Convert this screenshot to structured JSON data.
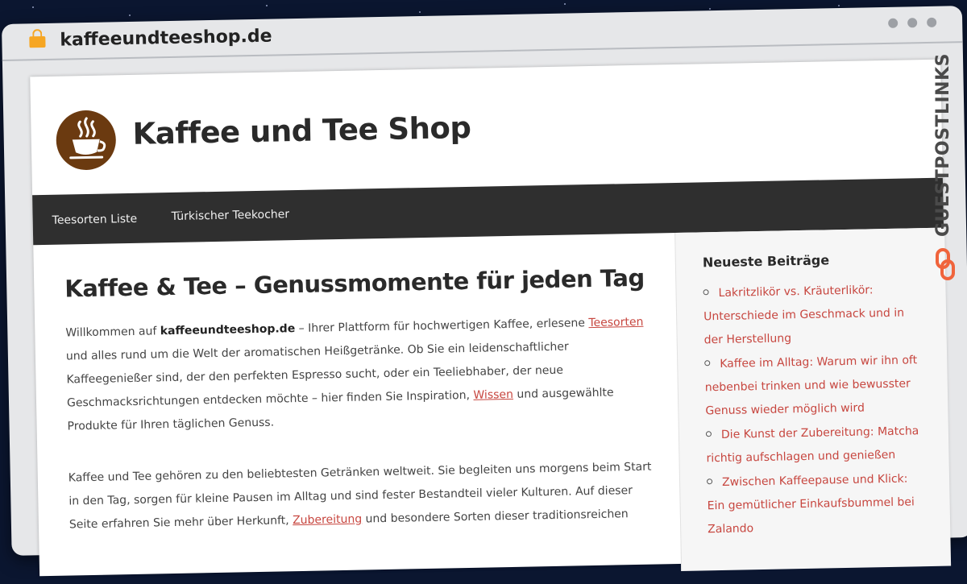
{
  "browser": {
    "url": "kaffeeundteeshop.de"
  },
  "site": {
    "title": "Kaffee und Tee Shop",
    "logo_icon": "coffee-cup-icon",
    "brand_color": "#6b3a10"
  },
  "nav": {
    "items": [
      {
        "label": "Teesorten Liste"
      },
      {
        "label": "Türkischer Teekocher"
      }
    ]
  },
  "main": {
    "headline": "Kaffee & Tee – Genussmomente für jeden Tag",
    "para1": {
      "t1": "Willkommen auf ",
      "bold": "kaffeeundteeshop.de",
      "t2": " – Ihrer Plattform für hochwertigen Kaffee, erlesene ",
      "link1": "Teesorten",
      "t3": " und alles rund um die Welt der aromatischen Heißgetränke. Ob Sie ein leidenschaftlicher Kaffeegenießer sind, der den perfekten Espresso sucht, oder ein Teeliebhaber, der neue Geschmacksrichtungen entdecken möchte – hier finden Sie Inspiration, ",
      "link2": "Wissen",
      "t4": " und ausgewählte Produkte für Ihren täglichen Genuss."
    },
    "para2": {
      "t1": "Kaffee und Tee gehören zu den beliebtesten Getränken weltweit. Sie begleiten uns morgens beim Start in den Tag, sorgen für kleine Pausen im Alltag und sind fester Bestandteil vieler Kulturen. Auf dieser Seite erfahren Sie mehr über Herkunft, ",
      "link1": "Zubereitung",
      "t2": " und besondere Sorten dieser traditionsreichen"
    },
    "link_color": "#c7463f"
  },
  "sidebar": {
    "title": "Neueste Beiträge",
    "posts": [
      {
        "label": "Lakritzlikör vs. Kräuterlikör: Unterschiede im Geschmack und in der Herstellung"
      },
      {
        "label": "Kaffee im Alltag: Warum wir ihn oft nebenbei trinken und wie bewusster Genuss wieder möglich wird"
      },
      {
        "label": "Die Kunst der Zubereitung: Matcha richtig aufschlagen und genießen"
      },
      {
        "label": "Zwischen Kaffeepause und Klick: Ein gemütlicher Einkaufsbummel bei Zalando"
      }
    ]
  },
  "badge": {
    "label": "GUESTPOSTLINKS",
    "icon": "chain-link-icon",
    "accent": "#f0643c"
  }
}
